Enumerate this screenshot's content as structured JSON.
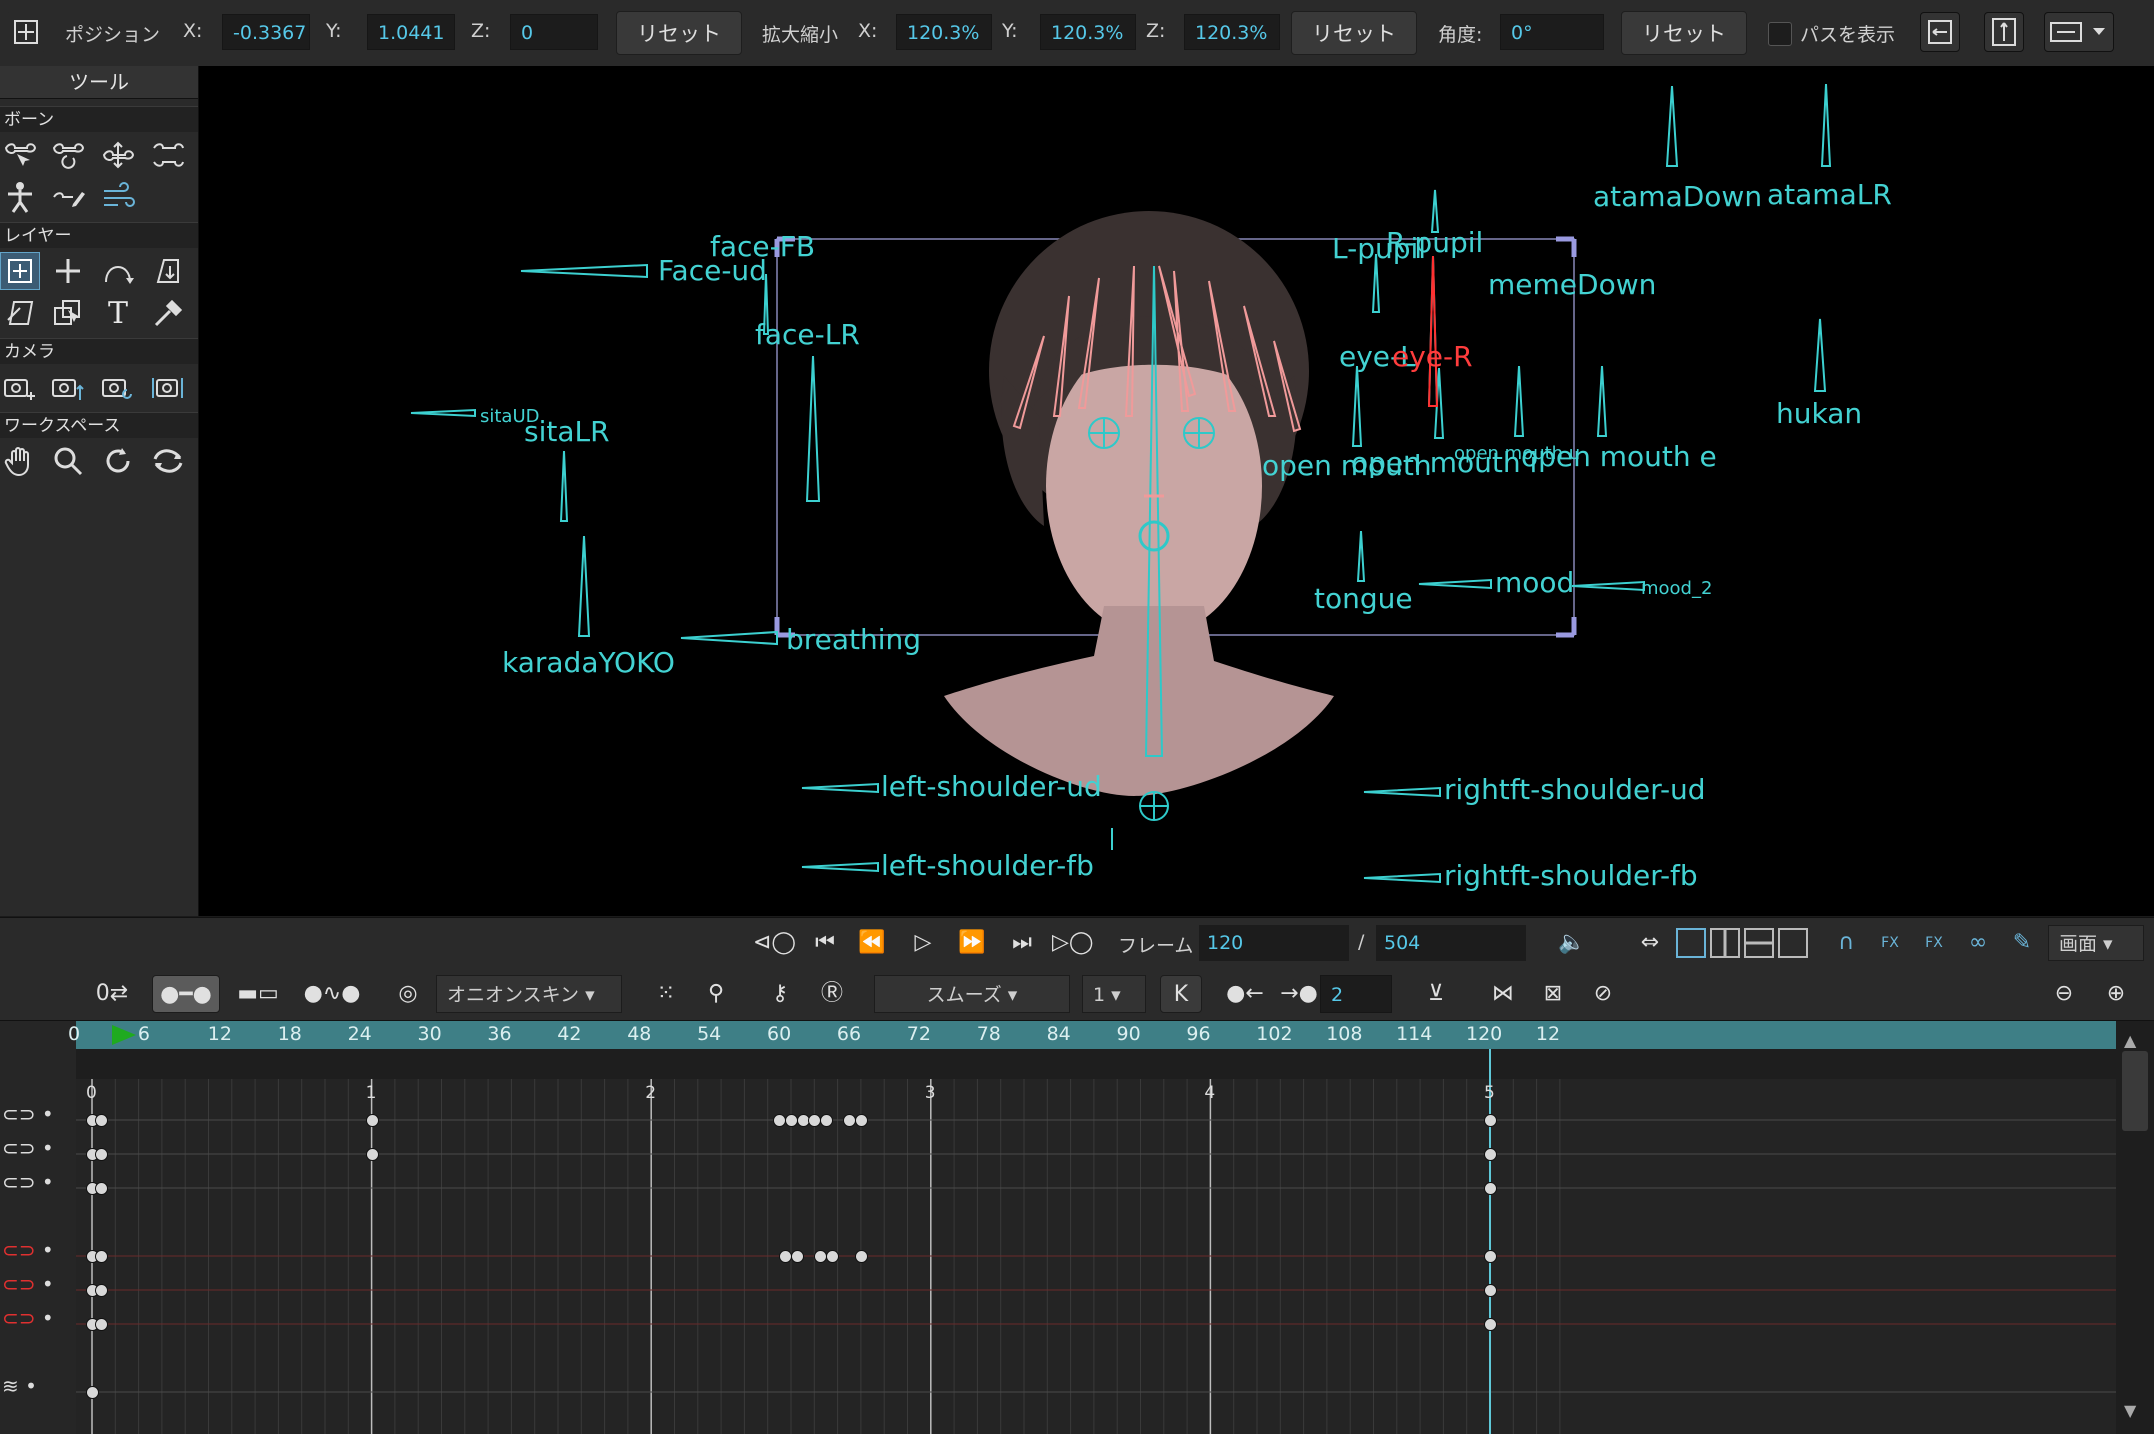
{
  "toolbar": {
    "position_label": "ポジション",
    "x_label": "X:",
    "x_value": "-0.3367",
    "y_label": "Y:",
    "y_value": "1.0441",
    "z_label": "Z:",
    "z_value": "0",
    "reset1": "リセット",
    "scale_label": "拡大縮小",
    "sx_label": "X:",
    "sx_value": "120.3%",
    "sy_label": "Y:",
    "sy_value": "120.3%",
    "sz_label": "Z:",
    "sz_value": "120.3%",
    "reset2": "リセット",
    "angle_label": "角度:",
    "angle_value": "0°",
    "reset3": "リセット",
    "show_path_label": "パスを表示"
  },
  "tool_panel": {
    "title": "ツール",
    "bone_section": "ボーン",
    "layer_section": "レイヤー",
    "camera_section": "カメラ",
    "workspace_section": "ワークスペース"
  },
  "canvas": {
    "labels": {
      "faceFB": "face-FB",
      "faceud": "Face-ud",
      "faceLR": "face-LR",
      "sitaUD": "sitaUD",
      "sitaLR": "sitaLR",
      "karadaYOKO": "karadaYOKO",
      "breathing": "breathing",
      "lpupil": "L-pupil",
      "rpupil": "R-pupil",
      "atamaDown": "atamaDown",
      "atamaLR": "atamaLR",
      "memeDown": "memeDown",
      "eyeL": "eye-L",
      "eyeR": "eye-R",
      "hukan": "hukan",
      "openmouth1": "open mouth",
      "openmouth2": "open mouth i",
      "openmouth3": "open mouth u",
      "openmouth4": "open mouth e",
      "tongue": "tongue",
      "mood": "mood",
      "mood2": "mood_2",
      "lsud": "left-shoulder-ud",
      "lsfb": "left-shoulder-fb",
      "rsud": "rightft-shoulder-ud",
      "rsfb": "rightft-shoulder-fb"
    }
  },
  "playback": {
    "frame_label": "フレーム",
    "frame_value": "120",
    "slash": "/",
    "total_frames": "504",
    "screen_label": "画面"
  },
  "timeline_toolbar": {
    "zero_label": "0",
    "onion_skin": "オニオンスキン",
    "interp": "スムーズ",
    "step_value": "1",
    "key_k": "K",
    "count_value": "2"
  },
  "ruler": [
    "0",
    "6",
    "12",
    "18",
    "24",
    "30",
    "36",
    "42",
    "48",
    "54",
    "60",
    "66",
    "72",
    "78",
    "84",
    "90",
    "96",
    "102",
    "108",
    "114",
    "120",
    "12"
  ],
  "seconds": [
    "0",
    "1",
    "2",
    "3",
    "4",
    "5"
  ]
}
